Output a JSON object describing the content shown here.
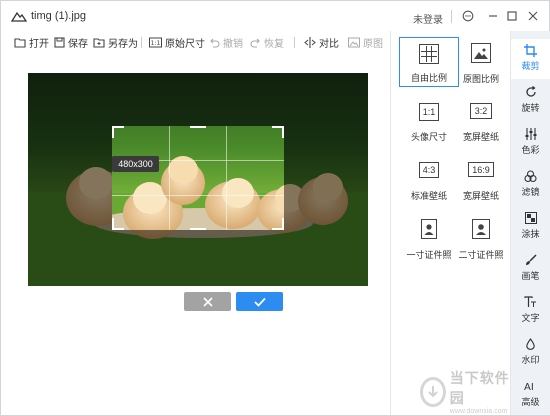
{
  "titlebar": {
    "title": "timg (1).jpg",
    "login": "未登录"
  },
  "toolbar": {
    "open": "打开",
    "save": "保存",
    "save_as": "另存为",
    "original_size": "原始尺寸",
    "undo": "撤销",
    "redo": "恢复",
    "compare": "对比",
    "original": "原图"
  },
  "canvas": {
    "size_tip": "480x300"
  },
  "ratios": [
    {
      "label": "自由比例",
      "icon_text": "",
      "selected": true
    },
    {
      "label": "原图比例",
      "icon_text": ""
    },
    {
      "label": "头像尺寸",
      "icon_text": "1:1"
    },
    {
      "label": "宽屏壁纸",
      "icon_text": "3:2"
    },
    {
      "label": "标准壁纸",
      "icon_text": "4:3"
    },
    {
      "label": "宽屏壁纸",
      "icon_text": "16:9"
    },
    {
      "label": "一寸证件照",
      "icon_text": ""
    },
    {
      "label": "二寸证件照",
      "icon_text": ""
    }
  ],
  "sidetabs": [
    {
      "label": "裁剪",
      "active": true
    },
    {
      "label": "旋转"
    },
    {
      "label": "色彩"
    },
    {
      "label": "滤镜"
    },
    {
      "label": "涂抹"
    },
    {
      "label": "画笔"
    },
    {
      "label": "文字"
    },
    {
      "label": "水印"
    },
    {
      "label": "高级"
    }
  ],
  "watermark": {
    "line1": "当下软件园",
    "line2": "www.downxia.com"
  },
  "colors": {
    "accent": "#2d8cf0",
    "cancel": "#a3a3a3"
  }
}
